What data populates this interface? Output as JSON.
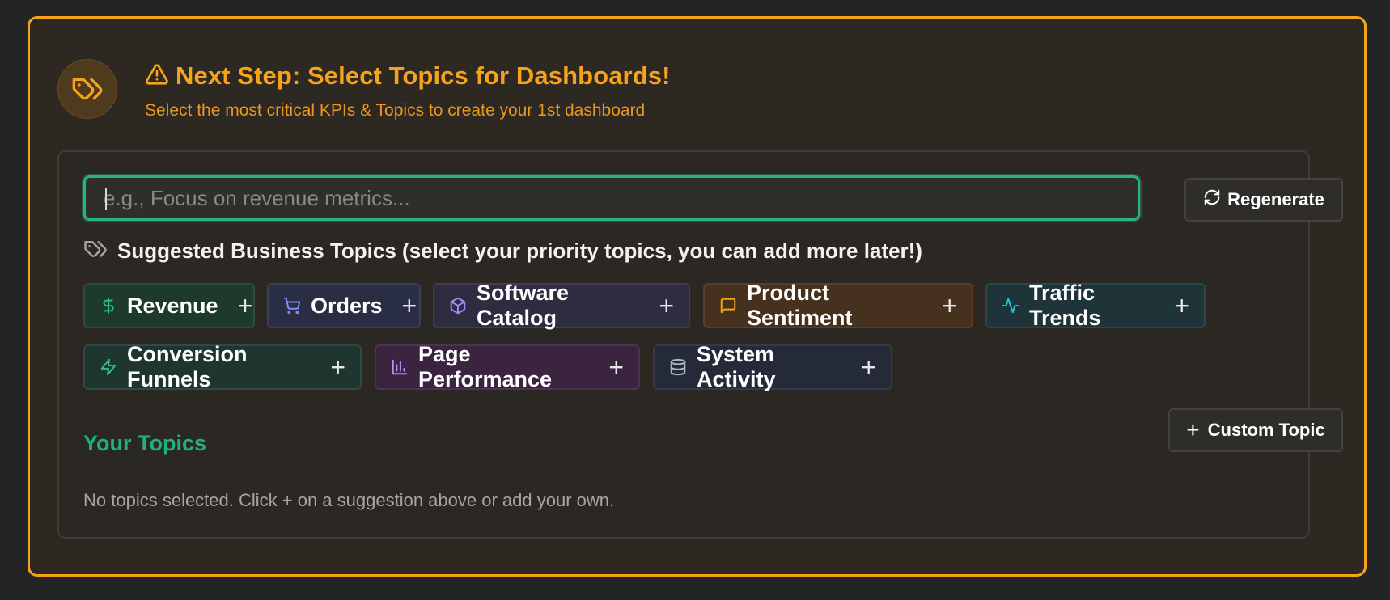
{
  "banner": {
    "title": "Next Step: Select Topics for Dashboards!",
    "subtitle": "Select the most critical KPIs & Topics to create your 1st dashboard"
  },
  "search": {
    "placeholder": "e.g., Focus on revenue metrics...",
    "value": ""
  },
  "regenerate_label": "Regenerate",
  "suggestions": {
    "heading": "Suggested Business Topics (select your priority topics, you can add more later!)",
    "chips": [
      {
        "label": "Revenue",
        "icon": "dollar-icon",
        "color": "#22c38a"
      },
      {
        "label": "Orders",
        "icon": "cart-icon",
        "color": "#7e8cf5"
      },
      {
        "label": "Software Catalog",
        "icon": "package-icon",
        "color": "#9a8cf0"
      },
      {
        "label": "Product Sentiment",
        "icon": "message-square-icon",
        "color": "#f5a31a"
      },
      {
        "label": "Traffic Trends",
        "icon": "activity-icon",
        "color": "#20c4d4"
      },
      {
        "label": "Conversion Funnels",
        "icon": "zap-icon",
        "color": "#22c38a"
      },
      {
        "label": "Page Performance",
        "icon": "bar-chart-icon",
        "color": "#c48cf0"
      },
      {
        "label": "System Activity",
        "icon": "database-icon",
        "color": "#b0b6c0"
      }
    ]
  },
  "your_topics": {
    "heading": "Your Topics",
    "custom_label": "Custom Topic",
    "empty_message": "No topics selected. Click + on a suggestion above or add your own."
  },
  "colors": {
    "accent": "#f5a31a",
    "green": "#20b27a"
  }
}
